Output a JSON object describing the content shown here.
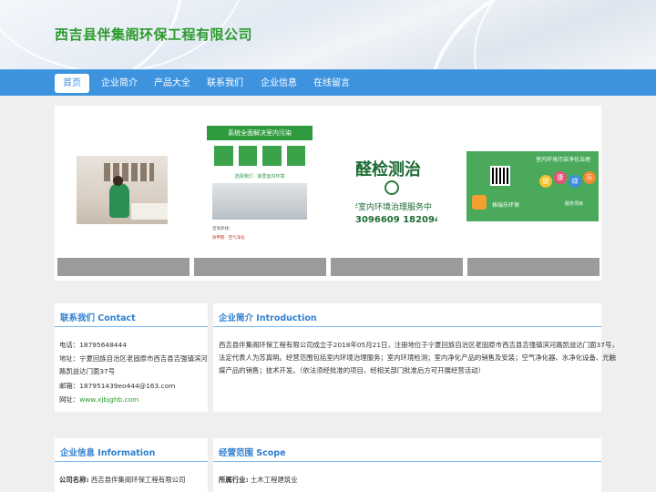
{
  "site": {
    "title": "西吉县伴集阁环保工程有限公司"
  },
  "nav": [
    {
      "label": "首页",
      "active": true
    },
    {
      "label": "企业简介"
    },
    {
      "label": "产品大全"
    },
    {
      "label": "联系我们"
    },
    {
      "label": "企业信息"
    },
    {
      "label": "在线留言"
    }
  ],
  "slides": [
    {
      "caption": ""
    },
    {
      "caption": "",
      "headline": "系统全面解决室内污染",
      "sub_text": "选择我们 · 家居室内环境",
      "foot_1": "咨询热线：",
      "foot_2": "除甲醛 · 空气净化"
    },
    {
      "caption": "",
      "big_text": "醛检测治",
      "mid_text": "伴室内环境治理服务中",
      "phones": "3096609  1820943"
    },
    {
      "caption": "",
      "title": "室内环境污染净化治理",
      "bubbles": [
        "健",
        "康",
        "绿",
        "乐"
      ],
      "brand": "格瑞乐环保",
      "note": "服务项目"
    }
  ],
  "contact": {
    "title": "联系我们 Contact",
    "phone_label": "电话：",
    "phone": "18795648444",
    "address_label": "地址：",
    "address_line1": "宁夏回族自治区老固原市西吉县吉强镇滨河",
    "address_line2": "路凯益达门面37号",
    "email_label": "邮箱：",
    "email": "187951439eo444@163.com",
    "web_label": "网址：",
    "web": "www.xjbjghb.com"
  },
  "intro": {
    "title": "企业简介 Introduction",
    "line1": "西吉县伴集阁环保工程有限公司成立于2018年05月21日，注册地位于宁夏回族自治区老固原市西吉县吉强镇滨河路凯益达门面37号，",
    "line2": "法定代表人为苏真明。经营范围包括室内环境治理服务；室内环境检测；室内净化产品的销售及安装；空气净化器、水净化设备、光触",
    "line3": "媒产品的销售；技术开发。（依法须经批准的项目，经相关部门批准后方可开展经营活动）"
  },
  "company_info": {
    "title": "企业信息 Information",
    "name_label": "公司名称:",
    "name": "西吉县伴集阁环保工程有限公司"
  },
  "scope": {
    "title": "经营范围 Scope",
    "industry_label": "所属行业:",
    "industry": "土木工程建筑业"
  },
  "colors": {
    "nav": "#3e93df",
    "title_green": "#2c9a2c",
    "panel_title": "#2f7fd0"
  }
}
